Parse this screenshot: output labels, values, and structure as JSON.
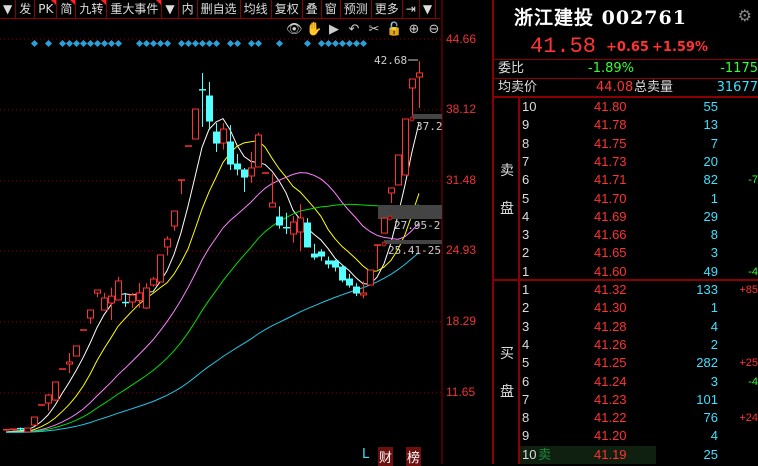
{
  "toolbar": {
    "items": [
      "▼",
      "发",
      "PK",
      "简",
      "九转",
      "重大事件",
      "▼",
      "内",
      "删自选",
      "均线",
      "复权",
      "叠",
      "窗",
      "预测",
      "更多",
      "⇥",
      "▼"
    ],
    "flagged": [
      2,
      3,
      4,
      5
    ]
  },
  "chart_icons": [
    "eye-icon",
    "hand-icon",
    "play-icon",
    "undo-icon",
    "scissors-icon",
    "lock-icon",
    "zoom-in-icon",
    "zoom-out-icon"
  ],
  "stock": {
    "name": "浙江建投",
    "code": "002761",
    "price": "41.58",
    "change": "+0.65",
    "change_pct": "+1.59%"
  },
  "ratio": {
    "label": "委比",
    "pct": "-1.89%",
    "diff": "-1175"
  },
  "avg": {
    "label": "均卖价",
    "price": "44.08",
    "total_label": "总卖量",
    "total": "31677"
  },
  "sell_label": [
    "卖",
    "盘"
  ],
  "buy_label": [
    "买",
    "盘"
  ],
  "sell": [
    {
      "n": "10",
      "p": "41.80",
      "v": "55",
      "d": ""
    },
    {
      "n": "9",
      "p": "41.78",
      "v": "13",
      "d": ""
    },
    {
      "n": "8",
      "p": "41.75",
      "v": "7",
      "d": ""
    },
    {
      "n": "7",
      "p": "41.73",
      "v": "20",
      "d": ""
    },
    {
      "n": "6",
      "p": "41.71",
      "v": "82",
      "d": "-7"
    },
    {
      "n": "5",
      "p": "41.70",
      "v": "1",
      "d": ""
    },
    {
      "n": "4",
      "p": "41.69",
      "v": "29",
      "d": ""
    },
    {
      "n": "3",
      "p": "41.66",
      "v": "8",
      "d": ""
    },
    {
      "n": "2",
      "p": "41.65",
      "v": "3",
      "d": ""
    },
    {
      "n": "1",
      "p": "41.60",
      "v": "49",
      "d": "-4"
    }
  ],
  "buy": [
    {
      "n": "1",
      "p": "41.32",
      "v": "133",
      "d": "+85"
    },
    {
      "n": "2",
      "p": "41.30",
      "v": "1",
      "d": ""
    },
    {
      "n": "3",
      "p": "41.28",
      "v": "4",
      "d": ""
    },
    {
      "n": "4",
      "p": "41.26",
      "v": "2",
      "d": ""
    },
    {
      "n": "5",
      "p": "41.25",
      "v": "282",
      "d": "+25"
    },
    {
      "n": "6",
      "p": "41.24",
      "v": "3",
      "d": "-4"
    },
    {
      "n": "7",
      "p": "41.23",
      "v": "101",
      "d": ""
    },
    {
      "n": "8",
      "p": "41.22",
      "v": "76",
      "d": "+24"
    },
    {
      "n": "9",
      "p": "41.20",
      "v": "4",
      "d": ""
    },
    {
      "n": "10",
      "p": "41.19",
      "v": "25",
      "d": "",
      "tag": "卖"
    }
  ],
  "bottom": {
    "l": "L",
    "cai": "财",
    "bang": "榜"
  },
  "colors": {
    "up": "#ff3333",
    "down": "#54ffff",
    "ma5": "#ffffff",
    "ma10": "#ffff00",
    "ma20": "#ff80ff",
    "ma30": "#00e000",
    "ma60": "#20c8e8"
  },
  "chart_data": {
    "type": "candlestick",
    "yticks": [
      "44.66",
      "38.12",
      "31.48",
      "24.93",
      "18.29",
      "11.65"
    ],
    "ylim": [
      7.6,
      44.66
    ],
    "annotations": {
      "high": "42.68",
      "label1": "37.2",
      "label2": "27.95-2",
      "label3": "25.41-25"
    },
    "candles_ohlc": [
      [
        8.2,
        8.3,
        8.1,
        8.2
      ],
      [
        8.2,
        8.3,
        8.1,
        8.25
      ],
      [
        8.3,
        8.4,
        8.1,
        8.2
      ],
      [
        8.0,
        8.4,
        8.0,
        8.36
      ],
      [
        8.64,
        9.4,
        8.6,
        9.39
      ],
      [
        10.52,
        10.52,
        10.52,
        10.52
      ],
      [
        10.7,
        11.55,
        10.0,
        11.45
      ],
      [
        10.98,
        12.7,
        10.9,
        12.67
      ],
      [
        13.88,
        13.88,
        13.88,
        13.88
      ],
      [
        14.35,
        15.38,
        13.51,
        14.54
      ],
      [
        15.1,
        16.04,
        15.1,
        16.04
      ],
      [
        17.53,
        17.53,
        17.53,
        17.53
      ],
      [
        18.65,
        19.4,
        18.1,
        19.4
      ],
      [
        20.99,
        21.27,
        20.6,
        21.27
      ],
      [
        19.4,
        21.0,
        19.4,
        20.52
      ],
      [
        20.06,
        21.5,
        18.47,
        20.7
      ],
      [
        20.34,
        22.5,
        20.34,
        22.12
      ],
      [
        20.1,
        21.0,
        19.7,
        20.0
      ],
      [
        20.15,
        21.0,
        19.6,
        20.8
      ],
      [
        20.3,
        21.93,
        19.6,
        21.0
      ],
      [
        19.59,
        21.9,
        19.5,
        21.46
      ],
      [
        21.74,
        22.5,
        21.6,
        22.3
      ],
      [
        22.02,
        24.6,
        22.0,
        24.55
      ],
      [
        25.3,
        26.3,
        24.5,
        26.04
      ],
      [
        27.26,
        28.66,
        26.8,
        28.66
      ],
      [
        31.56,
        31.56,
        30.25,
        31.56
      ],
      [
        34.74,
        34.74,
        34.74,
        34.74
      ],
      [
        35.4,
        38.2,
        35.4,
        38.2
      ],
      [
        40.0,
        41.57,
        36.52,
        39.9
      ],
      [
        39.42,
        40.73,
        36.24,
        37.08
      ],
      [
        36.05,
        36.9,
        34.18,
        35.02
      ],
      [
        35.02,
        36.9,
        34.4,
        36.33
      ],
      [
        35.12,
        36.7,
        32.5,
        33.06
      ],
      [
        33.06,
        34.0,
        32.0,
        32.59
      ],
      [
        32.5,
        32.69,
        30.44,
        31.84
      ],
      [
        31.94,
        34.2,
        31.3,
        32.69
      ],
      [
        32.78,
        36.0,
        32.78,
        35.77
      ],
      [
        32.22,
        32.22,
        32.22,
        32.22
      ],
      [
        29.04,
        32.12,
        29.04,
        29.41
      ],
      [
        28.1,
        29.1,
        27.0,
        27.35
      ],
      [
        27.1,
        28.5,
        26.5,
        27.07
      ],
      [
        26.51,
        28.2,
        25.7,
        27.63
      ],
      [
        26.7,
        29.3,
        24.9,
        28.01
      ],
      [
        27.54,
        28.0,
        25.3,
        25.3
      ],
      [
        24.64,
        25.6,
        24.1,
        24.36
      ],
      [
        24.83,
        25.1,
        24.0,
        24.45
      ],
      [
        23.99,
        24.4,
        23.3,
        23.71
      ],
      [
        23.99,
        24.1,
        23.0,
        23.42
      ],
      [
        23.42,
        23.6,
        22.0,
        22.21
      ],
      [
        22.3,
        22.8,
        21.5,
        21.74
      ],
      [
        21.55,
        21.9,
        20.7,
        20.99
      ],
      [
        20.81,
        22.1,
        20.5,
        20.99
      ],
      [
        21.74,
        23.14,
        21.7,
        23.14
      ],
      [
        25.48,
        25.48,
        23.2,
        25.48
      ],
      [
        26.6,
        28.0,
        26.6,
        28.0
      ],
      [
        30.35,
        30.82,
        29.41,
        30.82
      ],
      [
        31.1,
        33.9,
        31.1,
        33.9
      ],
      [
        32.03,
        37.27,
        32.03,
        37.27
      ],
      [
        40.17,
        41.01,
        37.64,
        41.01
      ],
      [
        41.2,
        42.68,
        38.3,
        41.58
      ]
    ],
    "ma_periods": [
      5,
      10,
      20,
      30,
      60
    ],
    "signal_markers": [
      3,
      5,
      7,
      8,
      9,
      10,
      11,
      12,
      13,
      14,
      15,
      18,
      19,
      20,
      21,
      22,
      24,
      25,
      26,
      27,
      28,
      29,
      31,
      32,
      34,
      35,
      38,
      42,
      44,
      45,
      46,
      47,
      48,
      49,
      50
    ]
  }
}
